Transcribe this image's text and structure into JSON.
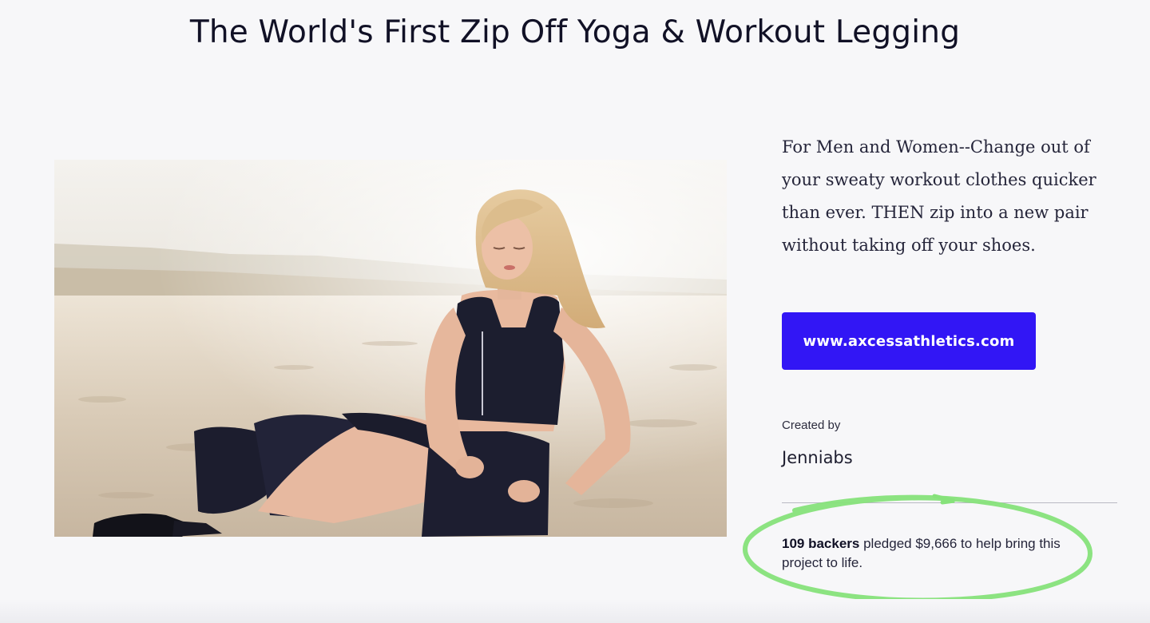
{
  "page": {
    "title": "The World's First Zip Off Yoga & Workout Legging"
  },
  "hero": {
    "image": "woman-in-zip-off-leggings-on-beach"
  },
  "project": {
    "blurb": "For Men and Women--Change out of your sweaty workout clothes quicker than ever. THEN zip into a new pair without taking off your shoes.",
    "website_button": "www.axcessathletics.com",
    "created_by_label": "Created by",
    "creator_name": "Jenniabs"
  },
  "funding": {
    "backers": "109 backers",
    "pledge_text": " pledged $9,666 to help bring this project to life."
  },
  "colors": {
    "accent": "#3216f5",
    "highlight_annotation": "#86e27a",
    "background": "#f7f7f9"
  }
}
